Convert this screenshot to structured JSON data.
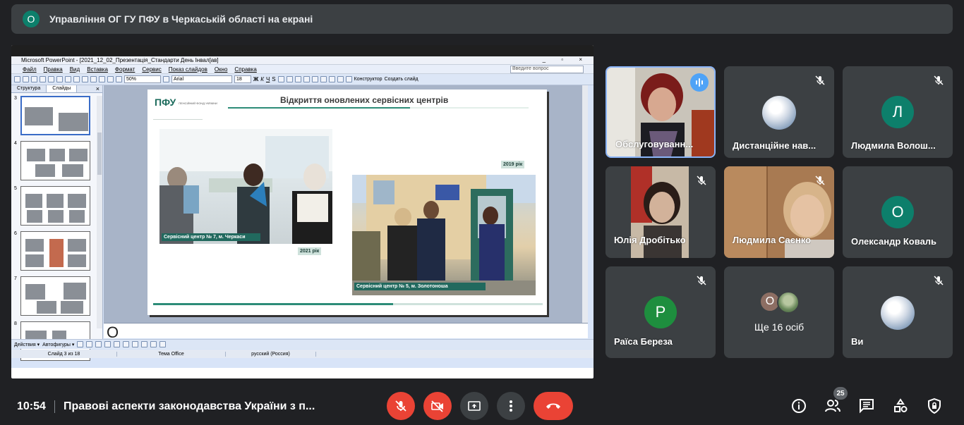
{
  "banner": {
    "avatar_letter": "О",
    "text": "Управління ОГ ГУ ПФУ в Черкаській області на екрані",
    "avatar_color": "#0d7f6b"
  },
  "powerpoint": {
    "window_title": "Microsoft PowerPoint - [2021_12_02_Презентація_Стандарти День Інвал[ав]",
    "window_buttons": "_ ▫ ×",
    "menu": [
      "Файл",
      "Правка",
      "Вид",
      "Вставка",
      "Формат",
      "Сервис",
      "Показ слайдов",
      "Окно",
      "Справка"
    ],
    "ask_placeholder": "Введите вопрос",
    "zoom": "50%",
    "font_name": "Arial",
    "font_size": "18",
    "designer_label": "Конструктор",
    "new_slide_label": "Создать слайд",
    "tabs": [
      "Структура",
      "Слайды"
    ],
    "thumb_numbers": [
      "3",
      "4",
      "5",
      "6",
      "7",
      "8"
    ],
    "slide": {
      "logo": "ПФУ",
      "logo_sub": "ПЕНСІЙНИЙ ФОНД УКРАЇНИ",
      "title": "Відкриття оновлених сервісних центрів",
      "caption1": "Сервісний центр № 7, м. Черкаси",
      "year1": "2021 рік",
      "year2": "2019 рік",
      "caption2": "Сервісний центр № 5, м. Золотоноша"
    },
    "notes_text": "О",
    "draw_actions": "Действия ▾",
    "autoshapes": "Автофигуры ▾",
    "status": {
      "slide": "Слайд 3 из 18",
      "theme": "Тема Office",
      "lang": "русский (Россия)"
    }
  },
  "participants": [
    {
      "name": "Обслуговуванн...",
      "type": "video",
      "speaking": true
    },
    {
      "name": "Дистанційне нав...",
      "type": "globe",
      "muted": true
    },
    {
      "name": "Людмила Волош...",
      "type": "avatar",
      "letter": "Л",
      "color": "#0d7f6b",
      "muted": true
    },
    {
      "name": "Юлія Дробітько",
      "type": "video",
      "muted": true
    },
    {
      "name": "Людмила Саєнко",
      "type": "video",
      "muted": true
    },
    {
      "name": "Олександр Коваль",
      "type": "avatar",
      "letter": "О",
      "color": "#0d7f6b"
    },
    {
      "name": "Раїса Береза",
      "type": "avatar",
      "letter": "Р",
      "color": "#1e8e3e",
      "muted": true
    },
    {
      "name": "Ще 16 осіб",
      "type": "more",
      "letter": "О"
    },
    {
      "name": "Ви",
      "type": "globe",
      "muted": true
    }
  ],
  "bottom": {
    "time": "10:54",
    "meeting_title": "Правові аспекти законодавства України з п...",
    "people_count": "25",
    "danger_color": "#ea4335"
  }
}
